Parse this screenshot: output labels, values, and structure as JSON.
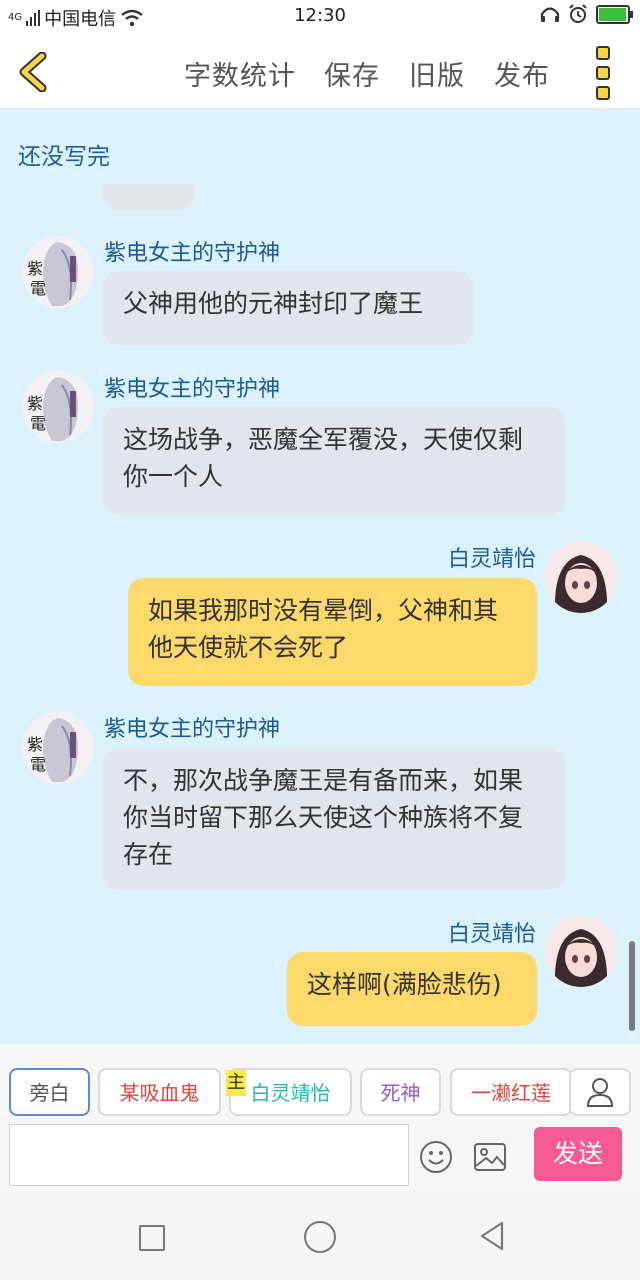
{
  "status_bar": {
    "network": "4G",
    "carrier": "中国电信",
    "time": "12:30",
    "battery_level": 0.9
  },
  "toolbar": {
    "word_count": "字数统计",
    "save": "保存",
    "old_version": "旧版",
    "publish": "发布"
  },
  "chat": {
    "status_title": "还没写完",
    "messages": [
      {
        "side": "left",
        "sender": "紫电女主的守护神",
        "text": "父神用他的元神封印了魔王"
      },
      {
        "side": "left",
        "sender": "紫电女主的守护神",
        "text": "这场战争，恶魔全军覆没，天使仅剩你一个人"
      },
      {
        "side": "right",
        "sender": "白灵靖怡",
        "text": "如果我那时没有晕倒，父神和其他天使就不会死了"
      },
      {
        "side": "left",
        "sender": "紫电女主的守护神",
        "text": "不，那次战争魔王是有备而来，如果你当时留下那么天使这个种族将不复存在"
      },
      {
        "side": "right",
        "sender": "白灵靖怡",
        "text": "这样啊(满脸悲伤)"
      }
    ]
  },
  "roles": {
    "chips": [
      {
        "label": "旁白",
        "color": "#555555"
      },
      {
        "label": "某吸血鬼",
        "color": "#e0443c"
      },
      {
        "label": "白灵靖怡",
        "color": "#2ab7b0"
      },
      {
        "label": "死神",
        "color": "#9b59d0"
      },
      {
        "label": "一濑红莲",
        "color": "#e0443c"
      }
    ],
    "main_tag": "主"
  },
  "composer": {
    "input_value": "",
    "send": "发送"
  }
}
